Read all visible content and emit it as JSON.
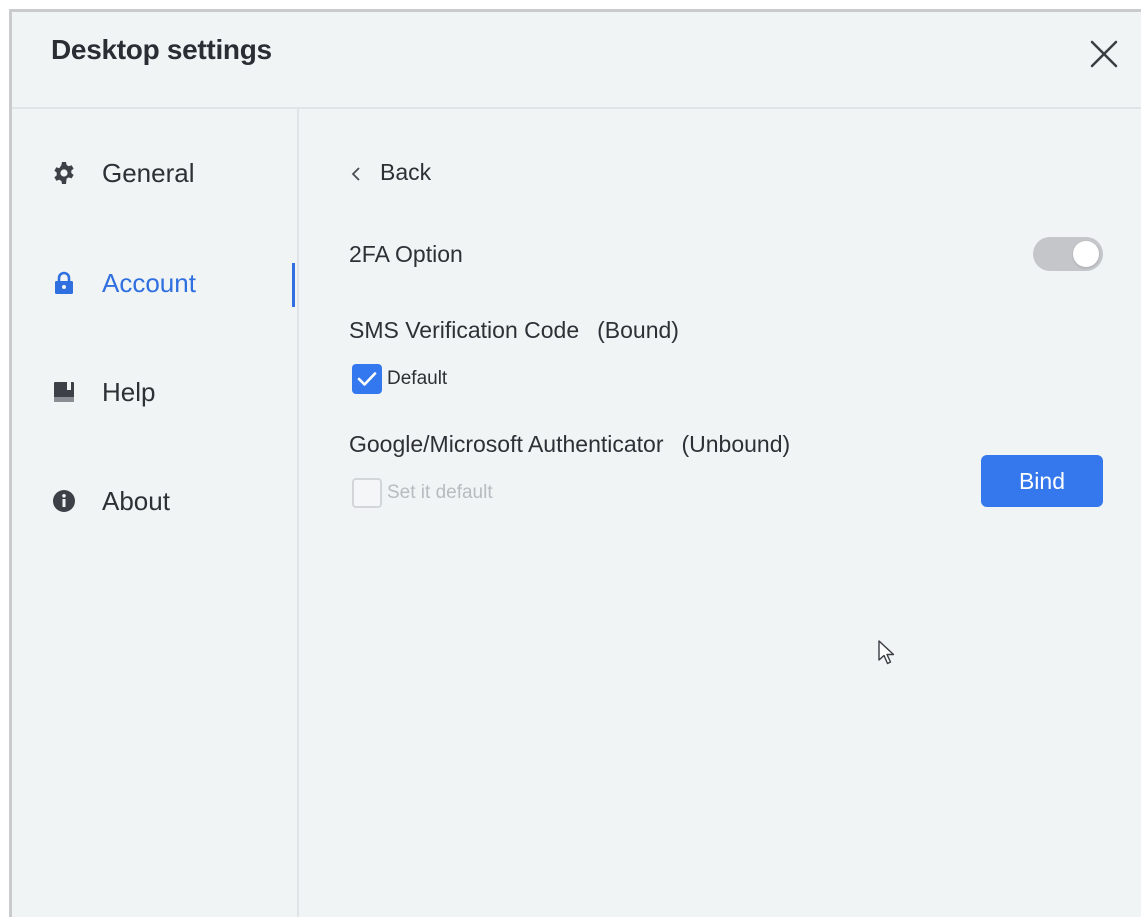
{
  "window": {
    "title": "Desktop settings"
  },
  "sidebar": {
    "items": [
      {
        "label": "General",
        "icon": "gear-icon"
      },
      {
        "label": "Account",
        "icon": "lock-icon",
        "active": true
      },
      {
        "label": "Help",
        "icon": "book-icon"
      },
      {
        "label": "About",
        "icon": "info-icon"
      }
    ]
  },
  "content": {
    "back_label": "Back",
    "twofa": {
      "label": "2FA Option",
      "enabled": true
    },
    "sms": {
      "label": "SMS Verification Code",
      "status": "(Bound)",
      "checkbox_label": "Default",
      "checked": true
    },
    "authenticator": {
      "label": "Google/Microsoft Authenticator",
      "status": "(Unbound)",
      "checkbox_label": "Set it default",
      "checked": false,
      "disabled": true,
      "button_label": "Bind"
    }
  },
  "colors": {
    "accent": "#2f6fe0",
    "button": "#3578ee",
    "background": "#f0f4f5"
  }
}
